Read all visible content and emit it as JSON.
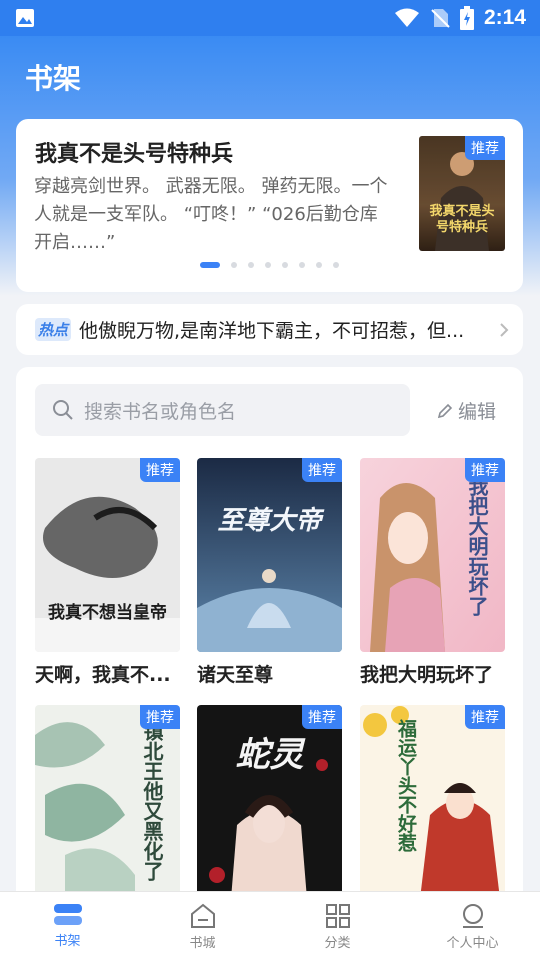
{
  "status_bar": {
    "time": "2:14"
  },
  "page": {
    "title": "书架"
  },
  "featured": {
    "title": "我真不是头号特种兵",
    "description": "穿越亮剑世界。 武器无限。 弹药无限。一个人就是一支军队。 “叮咚！” “026后勤仓库开启……”",
    "badge": "推荐",
    "cover_title": "我真不是头号特种兵",
    "dot_count": 8,
    "active_dot": 0
  },
  "hot": {
    "tag": "热点",
    "text": "他傲睨万物,是南洋地下霸主，不可招惹，但..."
  },
  "search": {
    "placeholder": "搜索书名或角色名",
    "edit_label": "编辑"
  },
  "books": [
    {
      "title": "天啊，我真不...",
      "badge": "推荐",
      "cover_title": "我真不想当皇帝"
    },
    {
      "title": "诸天至尊",
      "badge": "推荐",
      "cover_title": "至尊大帝"
    },
    {
      "title": "我把大明玩坏了",
      "badge": "推荐",
      "cover_title": "我把大明玩坏了"
    },
    {
      "title": "",
      "badge": "推荐",
      "cover_title": "镇北王他又黑化了"
    },
    {
      "title": "",
      "badge": "推荐",
      "cover_title": "蛇灵"
    },
    {
      "title": "",
      "badge": "推荐",
      "cover_title": "福运丫头不好惹"
    }
  ],
  "tabs": [
    {
      "label": "书架",
      "icon": "bookshelf-icon",
      "active": true
    },
    {
      "label": "书城",
      "icon": "bookstore-icon",
      "active": false
    },
    {
      "label": "分类",
      "icon": "category-icon",
      "active": false
    },
    {
      "label": "个人中心",
      "icon": "profile-icon",
      "active": false
    }
  ],
  "colors": {
    "accent": "#3b82f6",
    "header": "#2f7fef"
  }
}
